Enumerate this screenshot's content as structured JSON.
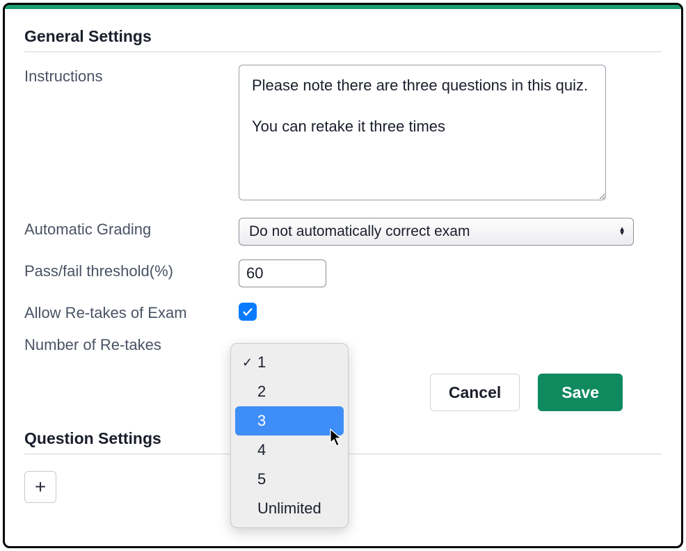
{
  "sections": {
    "general_title": "General Settings",
    "question_title": "Question Settings"
  },
  "labels": {
    "instructions": "Instructions",
    "automatic_grading": "Automatic Grading",
    "pass_fail_threshold": "Pass/fail threshold(%)",
    "allow_retakes": "Allow Re-takes of Exam",
    "number_retakes": "Number of Re-takes"
  },
  "values": {
    "instructions": "Please note there are three questions in this quiz.\n\nYou can retake it three times",
    "grading_selected": "Do not automatically correct exam",
    "threshold": "60",
    "allow_retakes_checked": true
  },
  "retake_options": {
    "items": [
      "1",
      "2",
      "3",
      "4",
      "5",
      "Unlimited"
    ],
    "current": "1",
    "hover": "3"
  },
  "buttons": {
    "cancel": "Cancel",
    "save": "Save"
  },
  "icons": {
    "add": "+",
    "checkmark": "✓"
  }
}
